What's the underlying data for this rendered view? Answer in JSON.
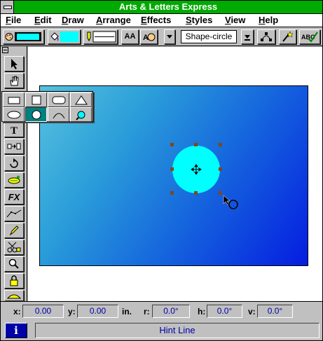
{
  "window": {
    "title": "Arts & Letters Express"
  },
  "menu": [
    "File",
    "Edit",
    "Draw",
    "Arrange",
    "Effects",
    "Styles",
    "View",
    "Help"
  ],
  "toolbar": {
    "shape_name": "Shape-circle",
    "line_color": "#00ffff",
    "fill_color": "#00ffff",
    "text_button": "AA"
  },
  "toolbox": {
    "tools": [
      "pointer-icon",
      "hand-icon",
      "shapes-icon",
      "ellipse-icon",
      "text-icon",
      "path-icon",
      "rotate-icon",
      "blend-icon",
      "fx-icon",
      "line-icon",
      "pen-icon",
      "scissors-icon",
      "zoom-icon",
      "lock-icon",
      "ruler-icon"
    ],
    "fx_label": "FX"
  },
  "shapes_flyout": [
    "rectangle-icon",
    "square-icon",
    "rounded-rect-icon",
    "triangle-icon",
    "ellipse-icon",
    "circle-icon",
    "arc-icon",
    "magnify-circle-icon"
  ],
  "drawing": {
    "rect_gradient": [
      "#5fd6ee",
      "#0520f0"
    ],
    "circle_fill": "#00ffff"
  },
  "coords": {
    "x_label": "x:",
    "x": "0.00",
    "y_label": "y:",
    "y": "0.00",
    "units": "in.",
    "r_label": "r:",
    "r": "0.0°",
    "h_label": "h:",
    "h": "0.0°",
    "v_label": "v:",
    "v": "0.0°"
  },
  "hint": {
    "info_label": "i",
    "text": "Hint Line"
  }
}
